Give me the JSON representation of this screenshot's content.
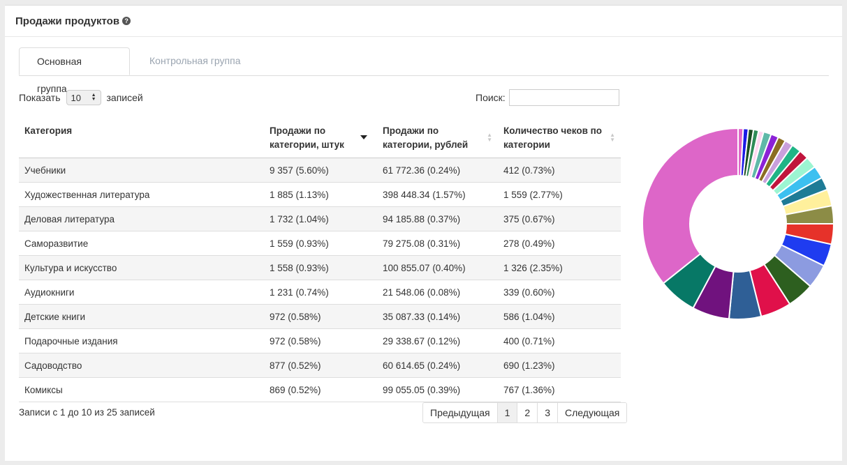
{
  "panel": {
    "title": "Продажи продуктов",
    "help_icon": "question-circle-icon"
  },
  "tabs": [
    {
      "label": "Основная группа",
      "active": true
    },
    {
      "label": "Контрольная группа",
      "active": false
    }
  ],
  "length": {
    "prefix": "Показать",
    "value": "10",
    "suffix": "записей"
  },
  "search": {
    "label": "Поиск:",
    "value": ""
  },
  "table": {
    "headers": [
      "Категория",
      "Продажи по категории, штук",
      "Продажи по категории, рублей",
      "Количество чеков по категории"
    ],
    "rows": [
      [
        "Учебники",
        "9 357 (5.60%)",
        "61 772.36 (0.24%)",
        "412 (0.73%)"
      ],
      [
        "Художественная литература",
        "1 885 (1.13%)",
        "398 448.34 (1.57%)",
        "1 559 (2.77%)"
      ],
      [
        "Деловая литература",
        "1 732 (1.04%)",
        "94 185.88 (0.37%)",
        "375 (0.67%)"
      ],
      [
        "Саморазвитие",
        "1 559 (0.93%)",
        "79 275.08 (0.31%)",
        "278 (0.49%)"
      ],
      [
        "Культура и искусство",
        "1 558 (0.93%)",
        "100 855.07 (0.40%)",
        "1 326 (2.35%)"
      ],
      [
        "Аудиокниги",
        "1 231 (0.74%)",
        "21 548.06 (0.08%)",
        "339 (0.60%)"
      ],
      [
        "Детские книги",
        "972 (0.58%)",
        "35 087.33 (0.14%)",
        "586 (1.04%)"
      ],
      [
        "Подарочные издания",
        "972 (0.58%)",
        "29 338.67 (0.12%)",
        "400 (0.71%)"
      ],
      [
        "Садоводство",
        "877 (0.52%)",
        "60 614.65 (0.24%)",
        "690 (1.23%)"
      ],
      [
        "Комиксы",
        "869 (0.52%)",
        "99 055.05 (0.39%)",
        "767 (1.36%)"
      ]
    ]
  },
  "info": "Записи с 1 до 10 из 25 записей",
  "pagination": {
    "prev": "Предыдущая",
    "pages": [
      "1",
      "2",
      "3"
    ],
    "current": "1",
    "next": "Следующая"
  },
  "chart_data": {
    "type": "pie",
    "donut": true,
    "slices": [
      {
        "value": 0.8,
        "color": "#e066c9"
      },
      {
        "value": 0.8,
        "color": "#1a1ae6"
      },
      {
        "value": 0.8,
        "color": "#1b4d22"
      },
      {
        "value": 0.8,
        "color": "#2e8b57"
      },
      {
        "value": 0.8,
        "color": "#ffd6f0"
      },
      {
        "value": 1.2,
        "color": "#5fb8a8"
      },
      {
        "value": 1.2,
        "color": "#8b22d6"
      },
      {
        "value": 1.2,
        "color": "#8b6d22"
      },
      {
        "value": 1.3,
        "color": "#c9a0dc"
      },
      {
        "value": 1.5,
        "color": "#20b486"
      },
      {
        "value": 1.5,
        "color": "#c0143c"
      },
      {
        "value": 1.8,
        "color": "#9cf5d2"
      },
      {
        "value": 2.0,
        "color": "#3cc0f0"
      },
      {
        "value": 2.0,
        "color": "#1e7b96"
      },
      {
        "value": 2.6,
        "color": "#fff09c"
      },
      {
        "value": 2.8,
        "color": "#8c8c46"
      },
      {
        "value": 3.2,
        "color": "#e6322a"
      },
      {
        "value": 3.5,
        "color": "#1f3cf0"
      },
      {
        "value": 3.8,
        "color": "#8c9be0"
      },
      {
        "value": 4.2,
        "color": "#2d5f1f"
      },
      {
        "value": 4.8,
        "color": "#e0104a"
      },
      {
        "value": 5.0,
        "color": "#2f5f96"
      },
      {
        "value": 5.8,
        "color": "#70127e"
      },
      {
        "value": 6.0,
        "color": "#077866"
      },
      {
        "value": 33.0,
        "color": "#dd66c8"
      }
    ]
  }
}
